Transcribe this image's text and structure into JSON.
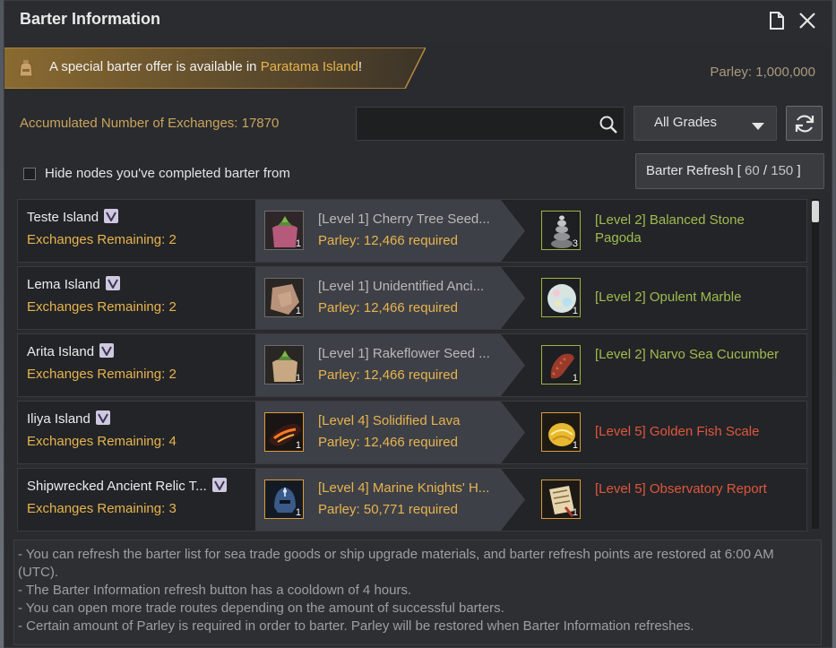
{
  "window": {
    "title": "Barter Information",
    "icons": {
      "save": "document-icon",
      "close": "close-icon"
    }
  },
  "banner": {
    "text_before": "A special barter offer is available in ",
    "location": "Paratama Island",
    "text_after": "!"
  },
  "parley": {
    "total": "Parley: 1,000,000"
  },
  "accumulated": {
    "label": "Accumulated Number of Exchanges: ",
    "value": "17870"
  },
  "search": {
    "placeholder": ""
  },
  "grade_filter": {
    "selected": "All Grades"
  },
  "hide_completed": {
    "label": "Hide nodes you've completed barter from",
    "checked": false
  },
  "barter_refresh": {
    "label": "Barter Refresh [ ",
    "current": "60",
    "sep": " / ",
    "max": "150",
    "end": " ]"
  },
  "rows": [
    {
      "node": "Teste Island",
      "exchanges_label": "Exchanges Remaining: ",
      "exchanges": "2",
      "input_item": "[Level 1] Cherry Tree Seed...",
      "input_qty": "1",
      "parley_label": "Parley: ",
      "parley_req": "12,466 required",
      "output_item": "[Level 2] Balanced Stone Pagoda",
      "output_qty": "3"
    },
    {
      "node": "Lema Island",
      "exchanges_label": "Exchanges Remaining: ",
      "exchanges": "2",
      "input_item": "[Level 1] Unidentified Anci...",
      "input_qty": "1",
      "parley_label": "Parley: ",
      "parley_req": "12,466 required",
      "output_item": "[Level 2] Opulent Marble",
      "output_qty": "1"
    },
    {
      "node": "Arita Island",
      "exchanges_label": "Exchanges Remaining: ",
      "exchanges": "2",
      "input_item": "[Level 1] Rakeflower Seed ...",
      "input_qty": "1",
      "parley_label": "Parley: ",
      "parley_req": "12,466 required",
      "output_item": "[Level 2] Narvo Sea Cucumber",
      "output_qty": "1"
    },
    {
      "node": "Iliya Island",
      "exchanges_label": "Exchanges Remaining: ",
      "exchanges": "4",
      "input_item": "[Level 4] Solidified Lava",
      "input_qty": "1",
      "parley_label": "Parley: ",
      "parley_req": "12,466 required",
      "output_item": "[Level 5] Golden Fish Scale",
      "output_qty": "1"
    },
    {
      "node": "Shipwrecked Ancient Relic T...",
      "exchanges_label": "Exchanges Remaining: ",
      "exchanges": "3",
      "input_item": "[Level 4] Marine Knights' H...",
      "input_qty": "1",
      "parley_label": "Parley: ",
      "parley_req": "50,771 required",
      "output_item": "[Level 5] Observatory Report",
      "output_qty": "1"
    }
  ],
  "notes": [
    "- You can refresh the barter list for sea trade goods or ship upgrade materials, and barter refresh points are restored at 6:00 AM (UTC).",
    "- The Barter Information refresh button has a cooldown of 4 hours.",
    "- You can open more trade routes depending on the amount of successful barters.",
    "- Certain amount of Parley is required in order to barter. Parley will be restored when Barter Information refreshes."
  ],
  "colors": {
    "gold": "#e6b44e",
    "green_item": "#9fbc4f",
    "red_item": "#e0563e",
    "panel": "#2a2b2e"
  }
}
